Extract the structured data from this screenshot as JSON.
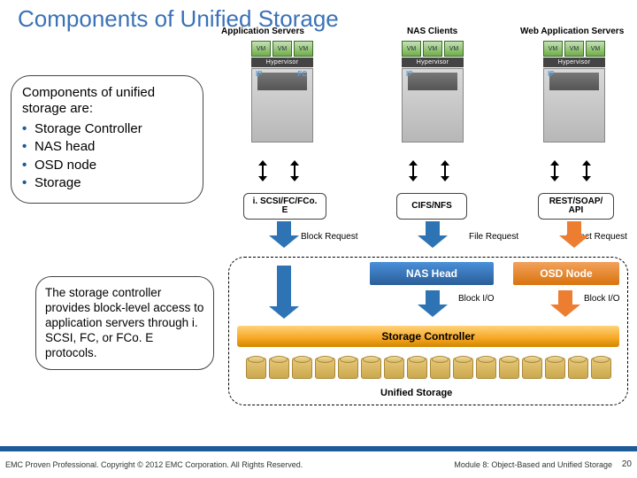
{
  "title": "Components of Unified Storage",
  "top": {
    "app_servers": "Application Servers",
    "nas_clients": "NAS Clients",
    "web_servers": "Web Application Servers"
  },
  "vm_label": "VM",
  "hypervisor": "Hypervisor",
  "port_ip": "IP",
  "port_fc": "FC",
  "callout1": {
    "lead": "Components of unified storage are:",
    "items": [
      "Storage Controller",
      "NAS head",
      "OSD node",
      "Storage"
    ]
  },
  "callout2": "The storage controller provides block-level access to application servers through i. SCSI, FC, or FCo. E protocols.",
  "protocols": {
    "block": "i. SCSI/FC/FCo. E",
    "file": "CIFS/NFS",
    "object": "REST/SOAP/\nAPI"
  },
  "requests": {
    "block": "Block Request",
    "file": "File Request",
    "object": "Object Request"
  },
  "nodes": {
    "nas": "NAS Head",
    "osd": "OSD Node"
  },
  "blockio": "Block I/O",
  "storage_controller": "Storage Controller",
  "unified": "Unified Storage",
  "footer": {
    "left": "EMC Proven Professional. Copyright © 2012 EMC Corporation. All Rights Reserved.",
    "right": "Module 8: Object-Based and Unified Storage",
    "page": "20"
  }
}
